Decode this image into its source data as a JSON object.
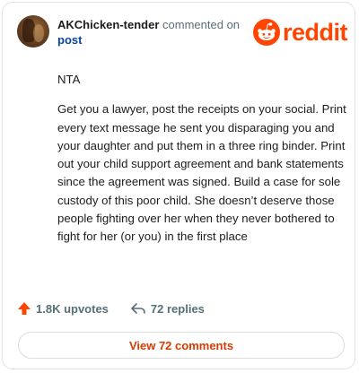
{
  "comment": {
    "username": "AKChicken-tender",
    "action_text": "commented on",
    "target": "post",
    "paragraphs": [
      "NTA",
      "Get you a lawyer, post the receipts on your social. Print every text message he sent you disparaging you and your daughter and put them in a three ring binder. Print out your child support agreement and bank statements since the agreement was signed. Build a case for sole custody of this poor child. She doesn’t deserve those people fighting over her when they never bothered to fight for her (or you) in the first place"
    ],
    "upvotes": "1.8K upvotes",
    "replies": "72 replies"
  },
  "brand": {
    "name": "reddit",
    "color": "#ff4500"
  },
  "footer": {
    "view_button": "View 72 comments"
  },
  "icons": {
    "upvote": "upvote-arrow-icon",
    "reply": "reply-arrow-icon",
    "logo": "reddit-snoo-icon"
  }
}
